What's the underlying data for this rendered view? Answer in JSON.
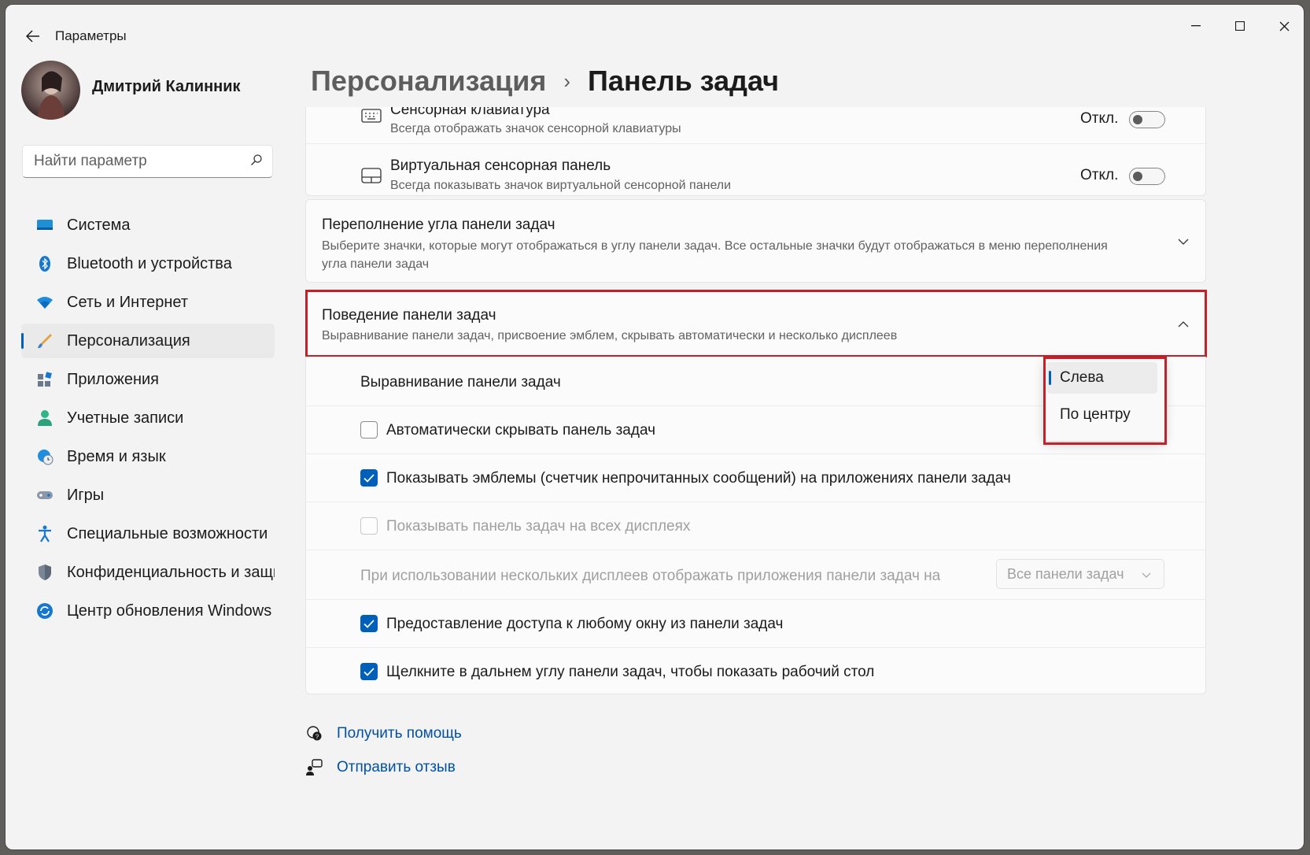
{
  "window": {
    "title": "Параметры"
  },
  "user": {
    "name": "Дмитрий Калинник"
  },
  "search": {
    "placeholder": "Найти параметр"
  },
  "sidebar": {
    "items": [
      {
        "label": "Система",
        "icon": "monitor-icon",
        "active": false
      },
      {
        "label": "Bluetooth и устройства",
        "icon": "bluetooth-icon",
        "active": false
      },
      {
        "label": "Сеть и Интернет",
        "icon": "wifi-icon",
        "active": false
      },
      {
        "label": "Персонализация",
        "icon": "brush-icon",
        "active": true
      },
      {
        "label": "Приложения",
        "icon": "apps-icon",
        "active": false
      },
      {
        "label": "Учетные записи",
        "icon": "person-icon",
        "active": false
      },
      {
        "label": "Время и язык",
        "icon": "clock-globe-icon",
        "active": false
      },
      {
        "label": "Игры",
        "icon": "gamepad-icon",
        "active": false
      },
      {
        "label": "Специальные возможности",
        "icon": "accessibility-icon",
        "active": false
      },
      {
        "label": "Конфиденциальность и защита",
        "icon": "shield-icon",
        "active": false
      },
      {
        "label": "Центр обновления Windows",
        "icon": "update-icon",
        "active": false
      }
    ]
  },
  "breadcrumb": {
    "parent": "Персонализация",
    "separator": "›",
    "current": "Панель задач"
  },
  "touch_keyboard": {
    "title": "Сенсорная клавиатура",
    "subtitle": "Всегда отображать значок сенсорной клавиатуры",
    "state": "Откл."
  },
  "virtual_touchpad": {
    "title": "Виртуальная сенсорная панель",
    "subtitle": "Всегда показывать значок виртуальной сенсорной панели",
    "state": "Откл."
  },
  "overflow": {
    "title": "Переполнение угла панели задач",
    "subtitle": "Выберите значки, которые могут отображаться в углу панели задач. Все остальные значки будут отображаться в меню переполнения угла панели задач"
  },
  "behavior": {
    "title": "Поведение панели задач",
    "subtitle": "Выравнивание панели задач, присвоение эмблем, скрывать автоматически и несколько дисплеев",
    "alignment_label": "Выравнивание панели задач",
    "alignment_options": [
      "Слева",
      "По центру"
    ],
    "alignment_selected": "Слева",
    "auto_hide": {
      "label": "Автоматически скрывать панель задач",
      "checked": false
    },
    "badges": {
      "label": "Показывать эмблемы (счетчик непрочитанных сообщений) на приложениях панели задач",
      "checked": true
    },
    "all_displays": {
      "label": "Показывать панель задач на всех дисплеях",
      "checked": false,
      "disabled": true
    },
    "multi_display_label": "При использовании нескольких дисплеев отображать приложения панели задач на",
    "multi_display_value": "Все панели задач",
    "share_window": {
      "label": "Предоставление доступа к любому окну из панели задач",
      "checked": true
    },
    "far_corner": {
      "label": "Щелкните в дальнем углу панели задач, чтобы показать рабочий стол",
      "checked": true
    }
  },
  "footer": {
    "help": "Получить помощь",
    "feedback": "Отправить отзыв"
  },
  "colors": {
    "accent": "#005fb8",
    "highlight": "#c4202a"
  }
}
